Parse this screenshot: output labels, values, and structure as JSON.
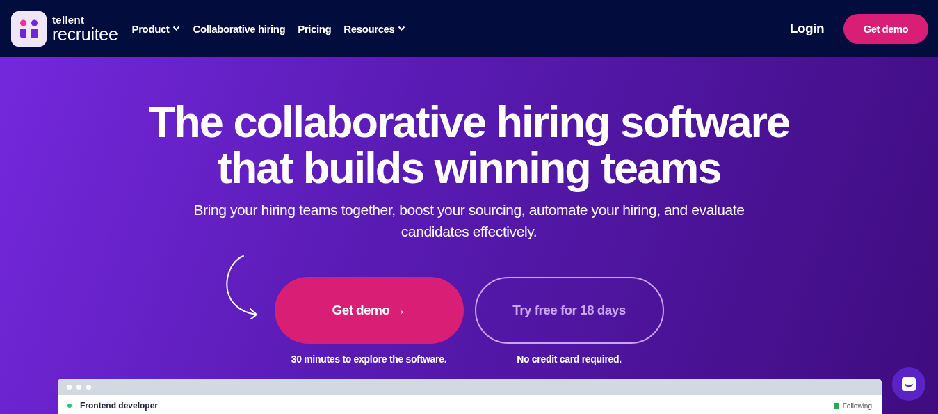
{
  "nav": {
    "logo": {
      "top": "tellent",
      "bottom": "recruitee"
    },
    "items": [
      {
        "label": "Product",
        "dropdown": true
      },
      {
        "label": "Collaborative hiring",
        "dropdown": false
      },
      {
        "label": "Pricing",
        "dropdown": false
      },
      {
        "label": "Resources",
        "dropdown": true
      }
    ],
    "login": "Login",
    "cta": "Get demo"
  },
  "hero": {
    "title_lines": [
      "The collaborative hiring software",
      "that builds winning teams"
    ],
    "subtitle": "Bring your hiring teams together, boost your sourcing, automate your hiring, and evaluate candidates effectively.",
    "actions": [
      {
        "kind": "primary",
        "label": "Get demo",
        "arrow": "→",
        "note": "30 minutes to explore the software."
      },
      {
        "kind": "outline",
        "label": "Try free for 18 days",
        "note": "No credit card required."
      }
    ]
  },
  "preview": {
    "job_title": "Frontend developer",
    "status": "Following"
  }
}
